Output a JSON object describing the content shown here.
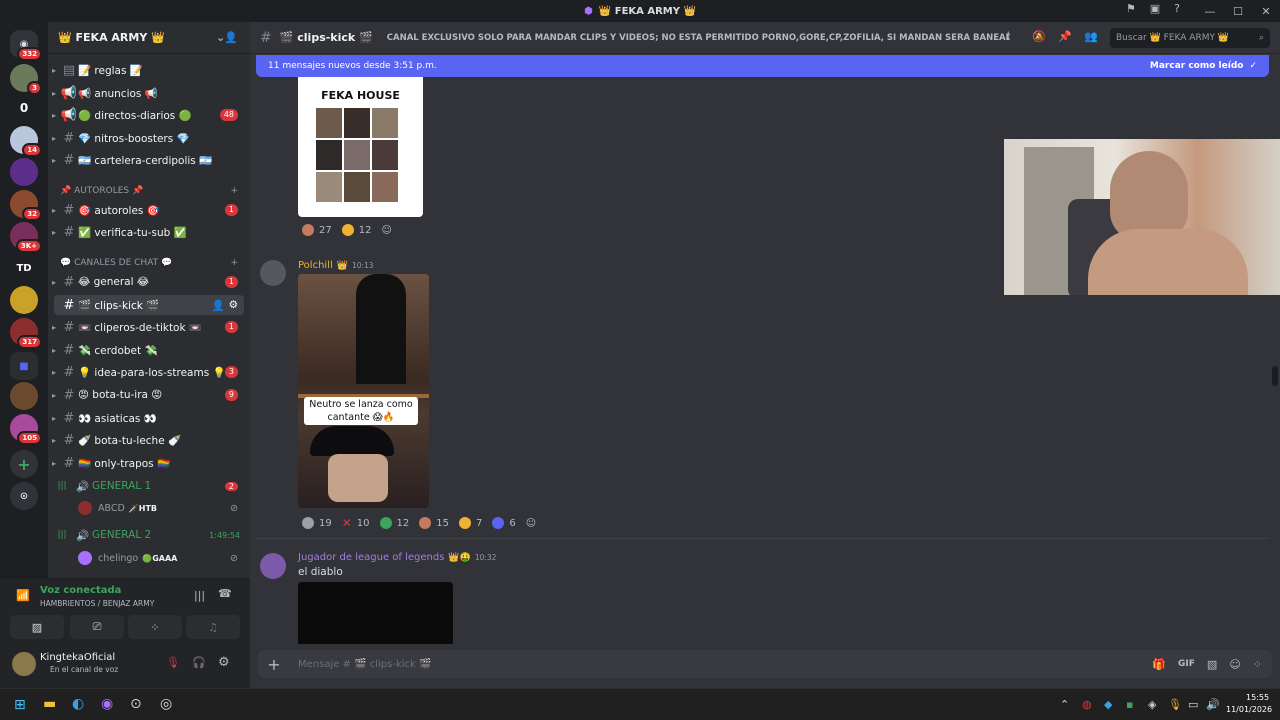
{
  "window": {
    "title": "FEKA ARMY",
    "title_prefix": "👑",
    "title_suffix": "👑",
    "min": "—",
    "max": "☐",
    "close": "✕"
  },
  "rail": {
    "badges": [
      "332",
      "3",
      "14",
      "32",
      "3K+",
      "317",
      "105"
    ],
    "labels": [
      "TD",
      "0"
    ]
  },
  "server": {
    "name": "👑 FEKA ARMY 👑"
  },
  "channels_top": [
    {
      "label": "📝 reglas 📝"
    },
    {
      "label": "📢 anuncios 📢"
    },
    {
      "label": "🟢 directos-diarios 🟢",
      "badge": "48"
    },
    {
      "label": "💎 nitros-boosters 💎"
    },
    {
      "label": "🇦🇷 cartelera-cerdipolis 🇦🇷"
    }
  ],
  "cat_autoroles": "📌 AUTOROLES 📌",
  "channels_auto": [
    {
      "label": "🎯 autoroles 🎯",
      "badge": "1"
    },
    {
      "label": "✅ verifica-tu-sub ✅"
    }
  ],
  "cat_chat": "💬 CANALES DE CHAT 💬",
  "channels_chat": [
    {
      "label": "😂 general 😂",
      "badge": "1"
    },
    {
      "label": "🎬 clips-kick 🎬",
      "active": true
    },
    {
      "label": "📼 cliperos-de-tiktok 📼",
      "badge": "1"
    },
    {
      "label": "💸 cerdobet 💸"
    },
    {
      "label": "💡 idea-para-los-streams 💡",
      "badge": "3"
    },
    {
      "label": "😡 bota-tu-ira 😡",
      "badge": "9"
    },
    {
      "label": "👀 asiaticas 👀"
    },
    {
      "label": "🍼 bota-tu-leche 🍼"
    },
    {
      "label": "🏳️‍🌈 only-trapos 🏳️‍🌈"
    }
  ],
  "voice_channels": [
    {
      "label": "GENERAL 1",
      "badge": "2",
      "members": [
        {
          "name": "ABCD",
          "tag": "🗡️HTB"
        }
      ]
    },
    {
      "label": "GENERAL 2",
      "time": "1:49:54",
      "members": [
        {
          "name": "chelingo",
          "tag": "🟢GAAA"
        }
      ]
    }
  ],
  "voice_panel": {
    "status": "Voz conectada",
    "channel": "HAMBRIENTOS / BENJAZ ARMY"
  },
  "user": {
    "name": "KingtekaOficial",
    "status": "En el canal de voz"
  },
  "channel": {
    "name": "🎬 clips-kick 🎬",
    "topic": "CANAL EXCLUSIVO SOLO PARA MANDAR CLIPS Y VIDEOS; NO ESTA PERMITIDO PORNO,GORE,CP,ZOFILIA, SI MANDAN SERA BANEADO PERMA...",
    "search_placeholder": "Buscar 👑 FEKA ARMY 👑"
  },
  "banner": {
    "text": "11 mensajes nuevos desde 3:51 p.m.",
    "action": "Marcar como leído"
  },
  "messages": [
    {
      "image_caption": "FEKA HOUSE",
      "reactions": [
        {
          "count": "27",
          "color": "#c77b5e"
        },
        {
          "count": "12",
          "color": "#f0b232"
        }
      ]
    },
    {
      "author": "Polchill",
      "author_color": "#f0b232",
      "badge": "👑",
      "time": "10:13",
      "overlay": "Neutro se lanza como cantante 😱🔥",
      "reactions": [
        {
          "count": "19",
          "color": "#9aa0a6"
        },
        {
          "count": "10",
          "color": "#da373c"
        },
        {
          "count": "12",
          "color": "#3ba55c"
        },
        {
          "count": "15",
          "color": "#c77b5e"
        },
        {
          "count": "7",
          "color": "#f0b232"
        },
        {
          "count": "6",
          "color": "#5865f2"
        }
      ]
    },
    {
      "author": "Jugador de league of legends",
      "author_color": "#a77ce0",
      "badge": "👑🤑",
      "time": "10:32",
      "text": "el diablo"
    }
  ],
  "composer": {
    "placeholder": "Mensaje # 🎬 clips-kick 🎬"
  },
  "taskbar": {
    "time": "15:55",
    "date": "11/01/2026"
  }
}
